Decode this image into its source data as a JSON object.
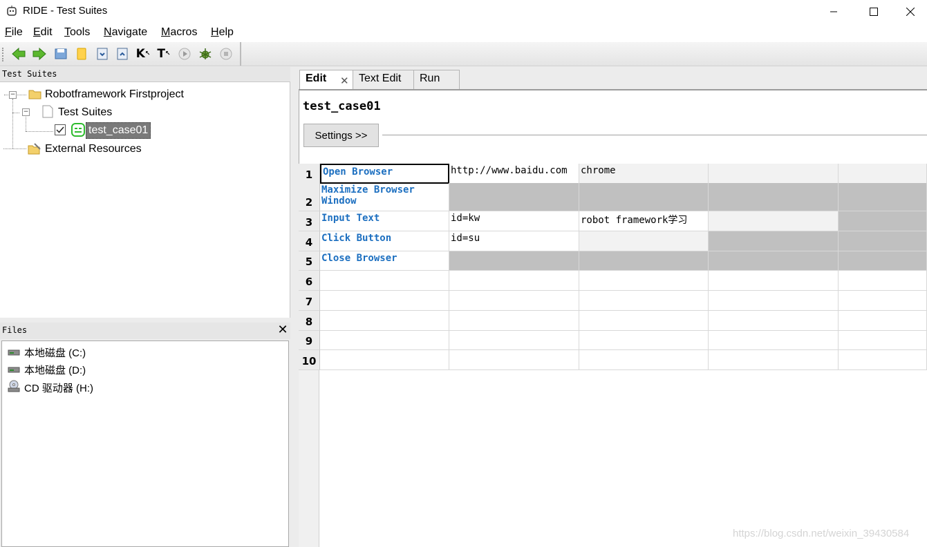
{
  "window": {
    "title": "RIDE - Test Suites"
  },
  "menu": [
    "File",
    "Edit",
    "Tools",
    "Navigate",
    "Macros",
    "Help"
  ],
  "toolbar": {
    "icons": [
      "back-icon",
      "forward-icon",
      "save-icon",
      "open-folder-icon",
      "import-icon",
      "export-icon",
      "keyword-search-icon",
      "test-search-icon",
      "run-icon",
      "debug-icon",
      "stop-icon"
    ]
  },
  "tree": {
    "header": "Test Suites",
    "root": "Robotframework Firstproject",
    "suite": "Test Suites",
    "test_case": "test_case01",
    "external": "External Resources"
  },
  "files": {
    "header": "Files",
    "drives": [
      "本地磁盘 (C:)",
      "本地磁盘 (D:)",
      "CD 驱动器 (H:)"
    ]
  },
  "tabs": [
    "Edit",
    "Text Edit",
    "Run"
  ],
  "editor": {
    "title": "test_case01",
    "settings_label": "Settings >>"
  },
  "grid": {
    "rows": [
      {
        "num": "1",
        "cells": [
          "Open Browser",
          "http://www.baidu.com",
          "chrome",
          "",
          ""
        ]
      },
      {
        "num": "2",
        "cells": [
          "Maximize Browser Window",
          "",
          "",
          "",
          ""
        ]
      },
      {
        "num": "3",
        "cells": [
          "Input Text",
          "id=kw",
          "robot framework学习",
          "",
          ""
        ]
      },
      {
        "num": "4",
        "cells": [
          "Click Button",
          "id=su",
          "",
          "",
          ""
        ]
      },
      {
        "num": "5",
        "cells": [
          "Close Browser",
          "",
          "",
          "",
          ""
        ]
      },
      {
        "num": "6",
        "cells": [
          "",
          "",
          "",
          "",
          ""
        ]
      },
      {
        "num": "7",
        "cells": [
          "",
          "",
          "",
          "",
          ""
        ]
      },
      {
        "num": "8",
        "cells": [
          "",
          "",
          "",
          "",
          ""
        ]
      },
      {
        "num": "9",
        "cells": [
          "",
          "",
          "",
          "",
          ""
        ]
      },
      {
        "num": "10",
        "cells": [
          "",
          "",
          "",
          "",
          ""
        ]
      }
    ]
  },
  "watermark": "https://blog.csdn.net/weixin_39430584"
}
